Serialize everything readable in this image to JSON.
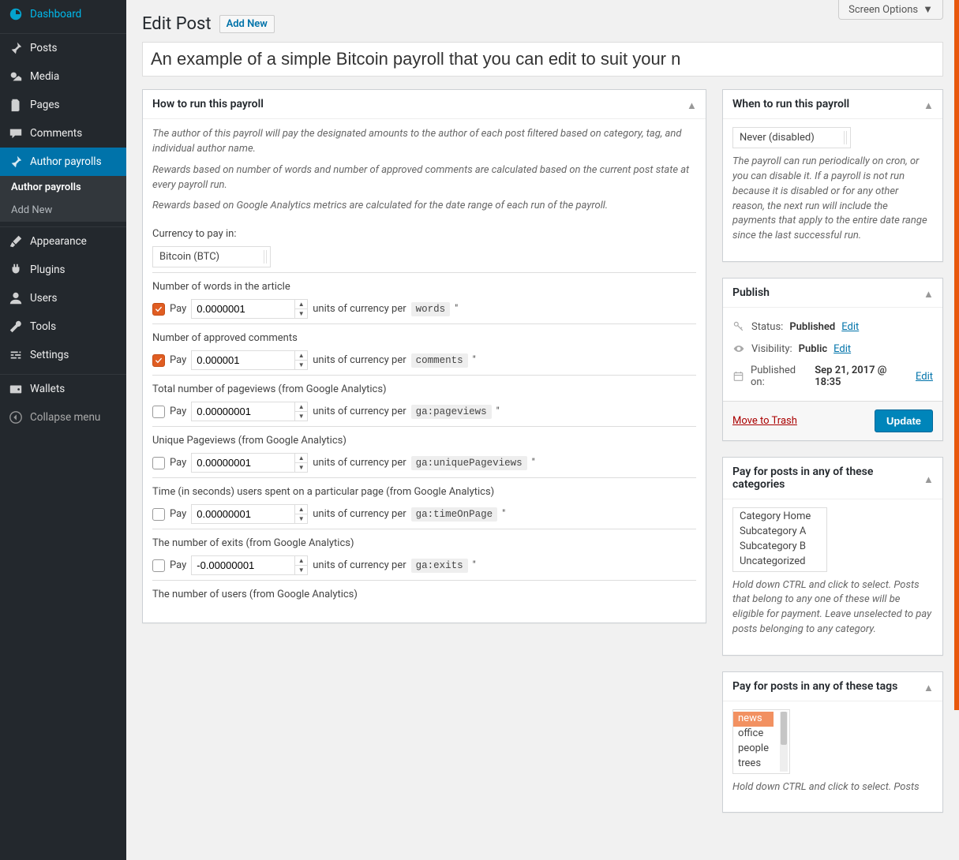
{
  "screen_options_label": "Screen Options",
  "sidebar": {
    "items": [
      {
        "key": "dashboard",
        "label": "Dashboard"
      },
      {
        "key": "posts",
        "label": "Posts"
      },
      {
        "key": "media",
        "label": "Media"
      },
      {
        "key": "pages",
        "label": "Pages"
      },
      {
        "key": "comments",
        "label": "Comments"
      },
      {
        "key": "author-payrolls",
        "label": "Author payrolls",
        "current": true
      },
      {
        "key": "appearance",
        "label": "Appearance"
      },
      {
        "key": "plugins",
        "label": "Plugins"
      },
      {
        "key": "users",
        "label": "Users"
      },
      {
        "key": "tools",
        "label": "Tools"
      },
      {
        "key": "settings",
        "label": "Settings"
      },
      {
        "key": "wallets",
        "label": "Wallets"
      }
    ],
    "submenu": [
      {
        "label": "Author payrolls",
        "active": true
      },
      {
        "label": "Add New"
      }
    ],
    "collapse_label": "Collapse menu"
  },
  "page": {
    "title": "Edit Post",
    "add_new": "Add New",
    "post_title": "An example of a simple Bitcoin payroll that you can edit to suit your n"
  },
  "howto": {
    "heading": "How to run this payroll",
    "p1": "The author of this payroll will pay the designated amounts to the author of each post filtered based on category, tag, and individual author name.",
    "p2": "Rewards based on number of words and number of approved comments are calculated based on the current post state at every payroll run.",
    "p3": "Rewards based on Google Analytics metrics are calculated for the date range of each run of the payroll.",
    "currency_label": "Currency to pay in:",
    "currency_value": "Bitcoin (BTC)",
    "pay_word": "Pay",
    "units_phrase": "units of currency per",
    "quote": "\"",
    "rows": [
      {
        "label": "Number of words in the article",
        "checked": true,
        "value": "0.0000001",
        "metric": "words"
      },
      {
        "label": "Number of approved comments",
        "checked": true,
        "value": "0.000001",
        "metric": "comments"
      },
      {
        "label": "Total number of pageviews (from Google Analytics)",
        "checked": false,
        "value": "0.00000001",
        "metric": "ga:pageviews"
      },
      {
        "label": "Unique Pageviews (from Google Analytics)",
        "checked": false,
        "value": "0.00000001",
        "metric": "ga:uniquePageviews"
      },
      {
        "label": "Time (in seconds) users spent on a particular page (from Google Analytics)",
        "checked": false,
        "value": "0.00000001",
        "metric": "ga:timeOnPage"
      },
      {
        "label": "The number of exits (from Google Analytics)",
        "checked": false,
        "value": "-0.00000001",
        "metric": "ga:exits"
      },
      {
        "label": "The number of users (from Google Analytics)",
        "checked": false,
        "value": "",
        "metric": ""
      }
    ]
  },
  "when": {
    "heading": "When to run this payroll",
    "value": "Never (disabled)",
    "help": "The payroll can run periodically on cron, or you can disable it. If a payroll is not run because it is disabled or for any other reason, the next run will include the payments that apply to the entire date range since the last successful run."
  },
  "publish": {
    "heading": "Publish",
    "status_label": "Status:",
    "status_value": "Published",
    "visibility_label": "Visibility:",
    "visibility_value": "Public",
    "published_label": "Published on:",
    "published_value": "Sep 21, 2017 @ 18:35",
    "edit": "Edit",
    "trash": "Move to Trash",
    "update": "Update"
  },
  "categories": {
    "heading": "Pay for posts in any of these categories",
    "options": [
      "Category Home",
      "Subcategory A",
      "Subcategory B",
      "Uncategorized"
    ],
    "help": "Hold down CTRL and click to select. Posts that belong to any one of these will be eligible for payment. Leave unselected to pay posts belonging to any category."
  },
  "tags": {
    "heading": "Pay for posts in any of these tags",
    "options": [
      "news",
      "office",
      "people",
      "trees"
    ],
    "selected": "news",
    "help": "Hold down CTRL and click to select. Posts"
  }
}
